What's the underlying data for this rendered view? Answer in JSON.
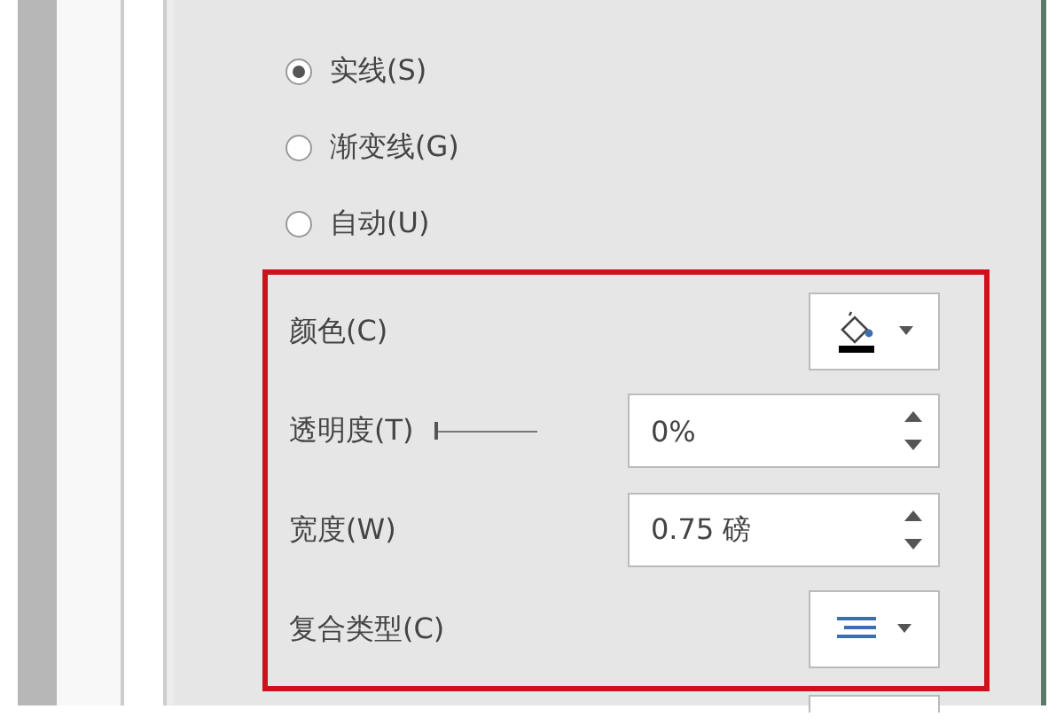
{
  "line_type_options": [
    {
      "label": "实线(S)",
      "selected": true
    },
    {
      "label": "渐变线(G)",
      "selected": false
    },
    {
      "label": "自动(U)",
      "selected": false
    }
  ],
  "line_settings": [
    {
      "kind": "color",
      "label": "颜色(C)"
    },
    {
      "kind": "spin",
      "label": "透明度(T)",
      "slider": {
        "level": 0
      },
      "value": "0%"
    },
    {
      "kind": "spin",
      "label": "宽度(W)",
      "value": "0.75 磅"
    },
    {
      "kind": "compound",
      "label": "复合类型(C)"
    }
  ]
}
